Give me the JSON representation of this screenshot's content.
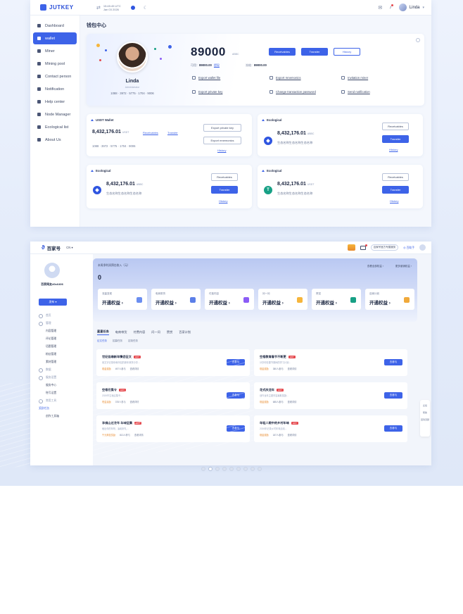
{
  "shot1": {
    "brand": "JUTKEY",
    "time_line1": "15:45:45 UTC",
    "time_line2": "Jan 03 2026",
    "user_name": "Linda",
    "nav": [
      {
        "label": "Dashboard"
      },
      {
        "label": "wallet"
      },
      {
        "label": "Miner"
      },
      {
        "label": "Mining pool"
      },
      {
        "label": "Contact person"
      },
      {
        "label": "Notification"
      },
      {
        "label": "Help center"
      },
      {
        "label": "Node Manager"
      },
      {
        "label": "Ecological list"
      },
      {
        "label": "About Us"
      }
    ],
    "page_title": "钱包中心",
    "profile": {
      "name": "Linda",
      "role": "Administrator",
      "id": "1088 · 3972 · 5775 · 1704 · 9006",
      "balance": "89000",
      "unit": "ABBC",
      "receivables": "Receivables",
      "transfer": "Transfer",
      "history": "History",
      "available_label": "可用：",
      "available_value": "89000.00",
      "available_link": "提现",
      "frozen_label": "冻结：",
      "frozen_value": "89000.00",
      "links": [
        "Export wallet file",
        "Export mnemonics",
        "Invitation miner",
        "Export private key",
        "Change transaction password",
        "Send notification"
      ]
    },
    "usdt": {
      "title": "USDT Wallet",
      "amount": "8,432,176.01",
      "unit": "USDT",
      "receivables": "Receivables",
      "transfer": "Transfer",
      "address": "1088 · 3972 · 5775 · 1704 · 9006",
      "export_key": "Export private key",
      "export_mn": "Export mnemonics",
      "history": "History"
    },
    "eco": [
      {
        "title": "Ecological",
        "amount": "8,432,176.01",
        "unit": "ABBC",
        "desc": "生态名称生态名称生态名称",
        "receivables": "Receivables",
        "transfer": "Transfer",
        "history": "History"
      },
      {
        "title": "Ecological",
        "amount": "8,432,176.01",
        "unit": "ABBC",
        "desc": "生态名称生态名称生态名称",
        "receivables": "Receivables",
        "transfer": "Transfer",
        "history": "History"
      },
      {
        "title": "Ecological",
        "amount": "8,432,176.01",
        "unit": "USDT",
        "desc": "生态名称生态名称生态名称",
        "receivables": "Receivables",
        "transfer": "Transfer",
        "history": "History"
      }
    ]
  },
  "shot2": {
    "brand": "百家号",
    "lang": "CN ▾",
    "pill": "百家号官方专属服务",
    "help": "◎ 百助手",
    "user": "百家网友d0c6406",
    "publish": "发布 ▾",
    "nav": [
      {
        "label": "首页",
        "kind": "grp"
      },
      {
        "label": "管理",
        "kind": "grp"
      },
      {
        "label": "内容管理",
        "kind": "sub"
      },
      {
        "label": "评论管理",
        "kind": "sub"
      },
      {
        "label": "话题管理",
        "kind": "sub"
      },
      {
        "label": "粉丝管理",
        "kind": "sub"
      },
      {
        "label": "素材管理",
        "kind": "sub"
      },
      {
        "label": "数据",
        "kind": "grp"
      },
      {
        "label": "服务设置",
        "kind": "grp"
      },
      {
        "label": "服务中心",
        "kind": "sub"
      },
      {
        "label": "账号设置",
        "kind": "sub"
      },
      {
        "label": "常用工具",
        "kind": "grp"
      },
      {
        "label": "奖励任务",
        "kind": "sel"
      },
      {
        "label": "创作工具箱",
        "kind": "sub"
      }
    ],
    "hero_title": "本周净利润预估收入（元）",
    "hero_value": "0",
    "hero_link1": "查看全部权益 ›",
    "hero_link2": "更多营销权益 ›",
    "quick": [
      {
        "title": "流量变现",
        "cta": "开通权益 ›",
        "color": "#6b8ef0"
      },
      {
        "title": "电商带货",
        "cta": "开通权益 ›",
        "color": "#5b7fe8"
      },
      {
        "title": "付费内容",
        "cta": "开通权益 ›",
        "color": "#8b5cf6"
      },
      {
        "title": "问一问",
        "cta": "开通权益 ›",
        "color": "#f6b53b"
      },
      {
        "title": "赞赏",
        "cta": "开通权益 ›",
        "color": "#17a085"
      },
      {
        "title": "百家计划",
        "cta": "开通权益 ›",
        "color": "#f0a93b"
      }
    ],
    "tabs": [
      "星星任务",
      "电商带货",
      "付费内容",
      "问一问",
      "赞赏",
      "百家计划"
    ],
    "subtabs": [
      "征文任务",
      "招募任务",
      "定制任务"
    ],
    "tasks": [
      {
        "title": "世纪佳缘新年情侣征文",
        "desc": "用文字记录你和伴侣的新年故事分享...",
        "tag": "现金奖励",
        "meta1": "497人参与",
        "meta2": "查看详情",
        "go": "去参与"
      },
      {
        "title": "空格教育春节不断更",
        "desc": "分享你在春节期间的学习计划...",
        "tag": "现金奖励",
        "meta1": "380人参与",
        "meta2": "查看详情",
        "go": "去参与"
      },
      {
        "title": "空格召集令",
        "desc": "2026年空格召集令...",
        "tag": "现金奖励",
        "meta1": "378人参与",
        "meta2": "查看详情",
        "go": "去参与"
      },
      {
        "title": "花式庆龙年",
        "desc": "创作龙年主题内容赢取奖励...",
        "tag": "现金奖励",
        "meta1": "685人参与",
        "meta2": "查看详情",
        "go": "去参与"
      },
      {
        "title": "李佛山过龙年 年味征集",
        "desc": "晒出你的年味，赢取好礼...",
        "tag": "千元现金奖励",
        "meta1": "813人参与",
        "meta2": "查看详情",
        "go": "去参与"
      },
      {
        "title": "年轻人眼中的乡村年味",
        "desc": "2026年记录乡村年味活动...",
        "tag": "现金奖励",
        "meta1": "187人参与",
        "meta2": "查看详情",
        "go": "去参与"
      }
    ],
    "float": [
      "反馈",
      "帮助",
      "回到顶部"
    ]
  }
}
